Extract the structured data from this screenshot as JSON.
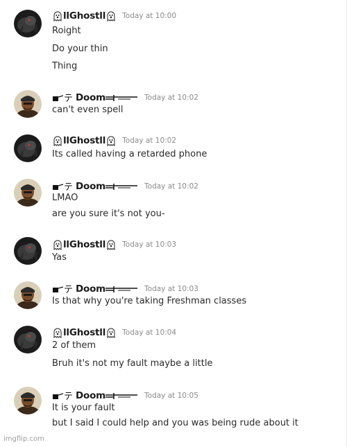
{
  "users": {
    "ghost": {
      "name": "llGhostll",
      "avatar_icon": "dark-creature-avatar",
      "name_icon": "ghost-emoji-icon"
    },
    "doom": {
      "name": "Doom",
      "avatar_icon": "man-with-bandana-avatar",
      "prefix_icon": "gun-glyph-icon",
      "prefix_char": "テ",
      "suffix_icon": "sword-glyph-icon"
    }
  },
  "messages": [
    {
      "user": "ghost",
      "timestamp": "Today at 10:00",
      "lines": [
        "Roight",
        "Do your thin",
        "Thing"
      ]
    },
    {
      "user": "doom",
      "timestamp": "Today at 10:02",
      "lines": [
        "can't even spell"
      ]
    },
    {
      "user": "ghost",
      "timestamp": "Today at 10:02",
      "lines": [
        "Its called having a retarded phone"
      ]
    },
    {
      "user": "doom",
      "timestamp": "Today at 10:02",
      "lines": [
        "LMAO",
        "are you sure it's not you-"
      ]
    },
    {
      "user": "ghost",
      "timestamp": "Today at 10:03",
      "lines": [
        "Yas"
      ]
    },
    {
      "user": "doom",
      "timestamp": "Today at 10:03",
      "lines": [
        "Is that why you're taking Freshman classes"
      ]
    },
    {
      "user": "ghost",
      "timestamp": "Today at 10:04",
      "lines": [
        "2 of them",
        "Bruh it's not my fault maybe a little"
      ]
    },
    {
      "user": "doom",
      "timestamp": "Today at 10:05",
      "lines": [
        "It is your fault",
        "but I said I could help and you was being rude about it"
      ]
    }
  ],
  "watermark": "imgflip.com"
}
